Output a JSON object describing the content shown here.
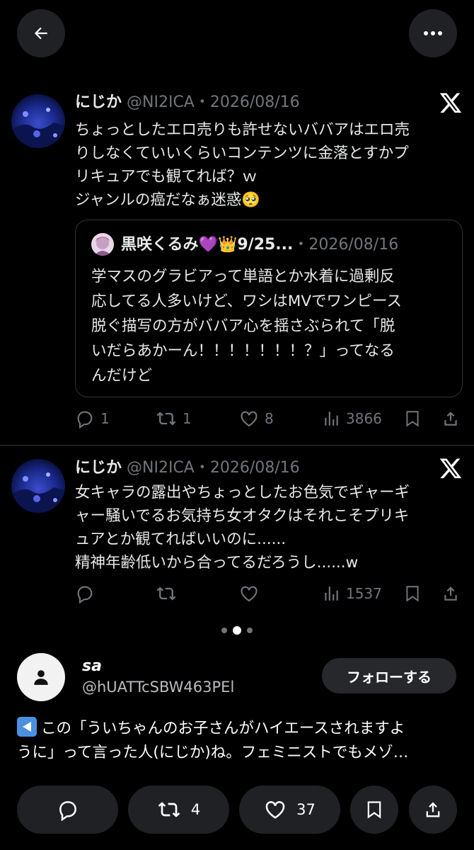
{
  "tweets": [
    {
      "name": "にじか",
      "handle": "@NI2ICA・2026/08/16",
      "text": "ちょっとしたエロ売りも許せないババアはエロ売\nりしなくていいくらいコンテンツに金落とすかプ\nリキュアでも観てれば？ｗ\nジャンルの癌だなぁ迷惑🥺",
      "quote": {
        "name": "黒咲くるみ💜👑9/25...",
        "date": "・2026/08/16",
        "text": "学マスのグラビアって単語とか水着に過剰反\n応してる人多いけど、ワシはMVでワンピース\n脱ぐ描写の方がババア心を揺さぶられて「脱\nいだらあかーん！！！！！！！？」ってなる\nんだけど"
      },
      "replies": "1",
      "reposts": "1",
      "likes": "8",
      "views": "3866"
    },
    {
      "name": "にじか",
      "handle": "@NI2ICA・2026/08/16",
      "text": "女キャラの露出やちょっとしたお色気でギャーギ\nャー騒いでるお気持ち女オタクはそれこそプリキ\nュアとか観てればいいのに......\n精神年齢低いから合ってるだろうし......w",
      "views": "1537"
    }
  ],
  "carousel": {
    "total": 3,
    "active_index": 1
  },
  "post": {
    "user_name": "sa",
    "user_handle": "@hUATTcSBW463PEl",
    "follow_label": "フォローする",
    "caption": "この「ういちゃんのお子さんがハイエースされますよ\nうに」って言った人(にじか)ね。フェミニストでもメゾ…",
    "reposts": "4",
    "likes": "37"
  },
  "colors": {
    "background": "#000000",
    "text": "#e7e9ea",
    "muted": "#71767b",
    "button_bg": "#1f2124",
    "border": "#2f3336"
  },
  "icons": [
    "back-arrow-icon",
    "more-dots-icon",
    "x-logo-icon",
    "reply-icon",
    "repost-icon",
    "like-icon",
    "views-icon",
    "bookmark-icon",
    "share-icon",
    "user-placeholder-icon",
    "back-arrow-emoji-icon"
  ]
}
